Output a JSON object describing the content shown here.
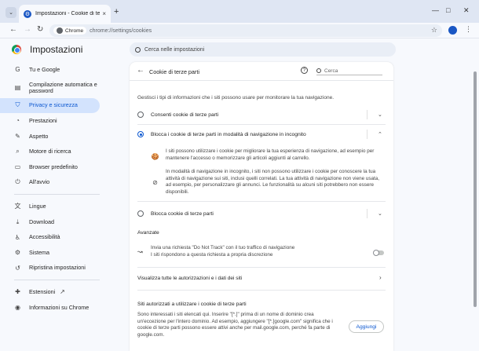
{
  "tab": {
    "title": "Impostazioni - Cookie di terze p",
    "close": "×",
    "new_tab": "+"
  },
  "window_controls": {
    "minimize": "—",
    "maximize": "□",
    "close": "✕"
  },
  "toolbar": {
    "back": "←",
    "forward": "→",
    "reload": "↻",
    "chip_label": "Chrome",
    "url": "chrome://settings/cookies",
    "bookmark": "☆",
    "menu": "⋮"
  },
  "header": {
    "title": "Impostazioni",
    "search_placeholder": "Cerca nelle impostazioni"
  },
  "sidebar": {
    "items": [
      {
        "label": "Tu e Google",
        "icon": "G"
      },
      {
        "label": "Compilazione automatica e password",
        "icon": "▤"
      },
      {
        "label": "Privacy e sicurezza",
        "icon": "⛉",
        "active": true
      },
      {
        "label": "Prestazioni",
        "icon": "◔"
      },
      {
        "label": "Aspetto",
        "icon": "✎"
      },
      {
        "label": "Motore di ricerca",
        "icon": "⌕"
      },
      {
        "label": "Browser predefinito",
        "icon": "▭"
      },
      {
        "label": "All'avvio",
        "icon": "⏻"
      }
    ],
    "items2": [
      {
        "label": "Lingue",
        "icon": "文"
      },
      {
        "label": "Download",
        "icon": "⤓"
      },
      {
        "label": "Accessibilità",
        "icon": "♿"
      },
      {
        "label": "Sistema",
        "icon": "⚙"
      },
      {
        "label": "Ripristina impostazioni",
        "icon": "↺"
      }
    ],
    "items3": [
      {
        "label": "Estensioni",
        "icon": "✚",
        "trailing": "↗"
      },
      {
        "label": "Informazioni su Chrome",
        "icon": "◉"
      }
    ]
  },
  "card": {
    "back": "←",
    "title": "Cookie di terze parti",
    "help": "?",
    "search_placeholder": "Cerca",
    "description": "Gestisci i tipi di informazioni che i siti possono usare per monitorare la tua navigazione.",
    "options": [
      {
        "label": "Consenti cookie di terze parti",
        "checked": false,
        "chevron": "⌄"
      },
      {
        "label": "Blocca i cookie di terze parti in modalità di navigazione in incognito",
        "checked": true,
        "chevron": "⌃"
      },
      {
        "label": "Blocca cookie di terze parti",
        "checked": false,
        "chevron": "⌄"
      }
    ],
    "details": [
      {
        "icon": "🍪",
        "text": "I siti possono utilizzare i cookie per migliorare la tua esperienza di navigazione, ad esempio per mantenere l'accesso o memorizzare gli articoli aggiunti al carrello."
      },
      {
        "icon": "⊘",
        "text": "In modalità di navigazione in incognito, i siti non possono utilizzare i cookie per conoscere la tua attività di navigazione sui siti, inclusi quelli correlati. La tua attività di navigazione non viene usata, ad esempio, per personalizzare gli annunci. Le funzionalità su alcuni siti potrebbero non essere disponibili."
      }
    ],
    "advanced": {
      "title": "Avanzate",
      "dnt_icon": "↝",
      "dnt_line1": "Invia una richiesta \"Do Not Track\" con il tuo traffico di navigazione",
      "dnt_line2": "I siti rispondono a questa richiesta a propria discrezione",
      "dnt_enabled": false
    },
    "view_all": {
      "label": "Visualizza tutte le autorizzazioni e i dati dei siti",
      "chevron": "›"
    },
    "sites": {
      "title": "Siti autorizzati a utilizzare i cookie di terze parti",
      "text": "Sono interessati i siti elencati qui. Inserire \"[*.]\" prima di un nome di dominio crea un'eccezione per l'intero dominio. Ad esempio, aggiungere \"[*.]google.com\" significa che i cookie di terze parti possono essere attivi anche per mail.google.com, perché fa parte di google.com.",
      "add_button": "Aggiungi"
    }
  },
  "colors": {
    "accent": "#0b57d0",
    "active_nav_bg": "#d3e3fd",
    "page_bg": "#f7f9fd",
    "frame_bg": "#dfe6f3"
  }
}
